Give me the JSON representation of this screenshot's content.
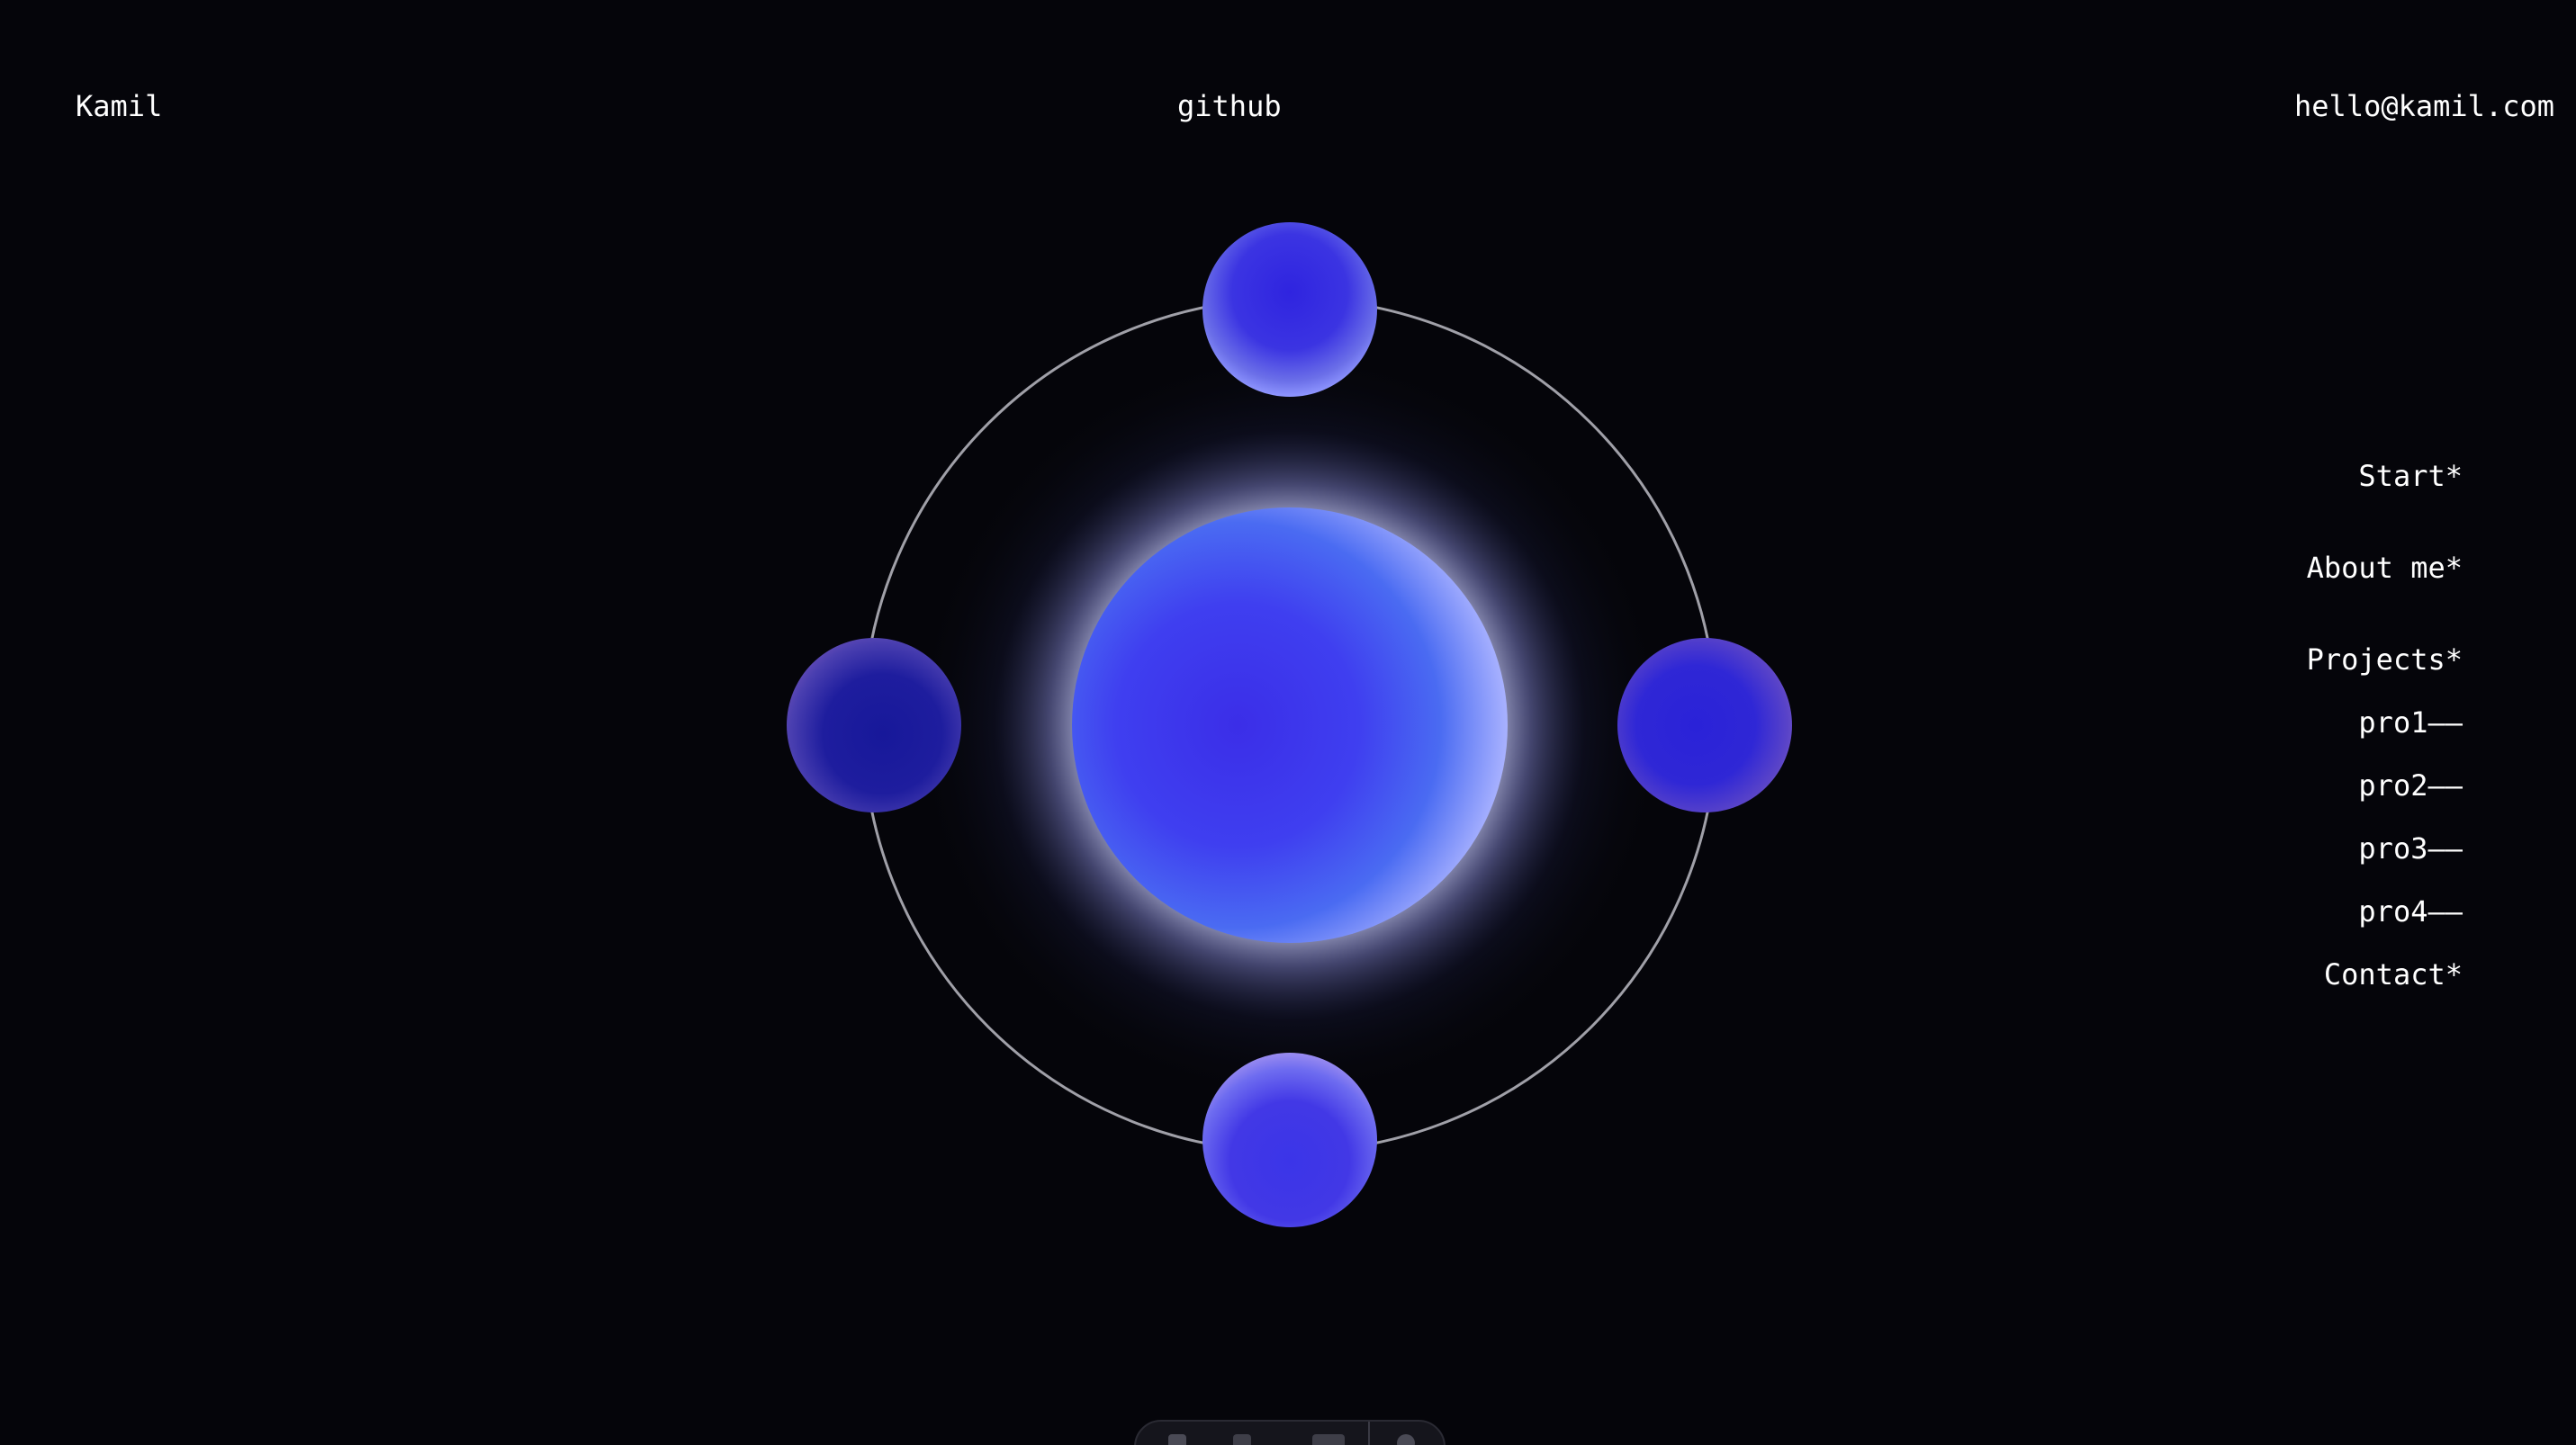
{
  "header": {
    "brand": "Kamil",
    "github": "github",
    "email": "hello@kamil.com"
  },
  "nav": {
    "items": [
      {
        "label": "Start*"
      },
      {
        "label": "About me*"
      },
      {
        "label": "Projects*"
      },
      {
        "label": "pro1––"
      },
      {
        "label": "pro2––"
      },
      {
        "label": "pro3––"
      },
      {
        "label": "pro4––"
      },
      {
        "label": "Contact*"
      }
    ]
  },
  "colors": {
    "background": "#05050a",
    "text": "#ffffff",
    "sphere_core": "#3b35e8",
    "sphere_light": "#9a9cff",
    "orbit": "#a0a0a8"
  },
  "icons": {
    "dock": [
      "toolbar-icon",
      "toolbar-icon",
      "toolbar-icon",
      "toolbar-icon"
    ]
  }
}
